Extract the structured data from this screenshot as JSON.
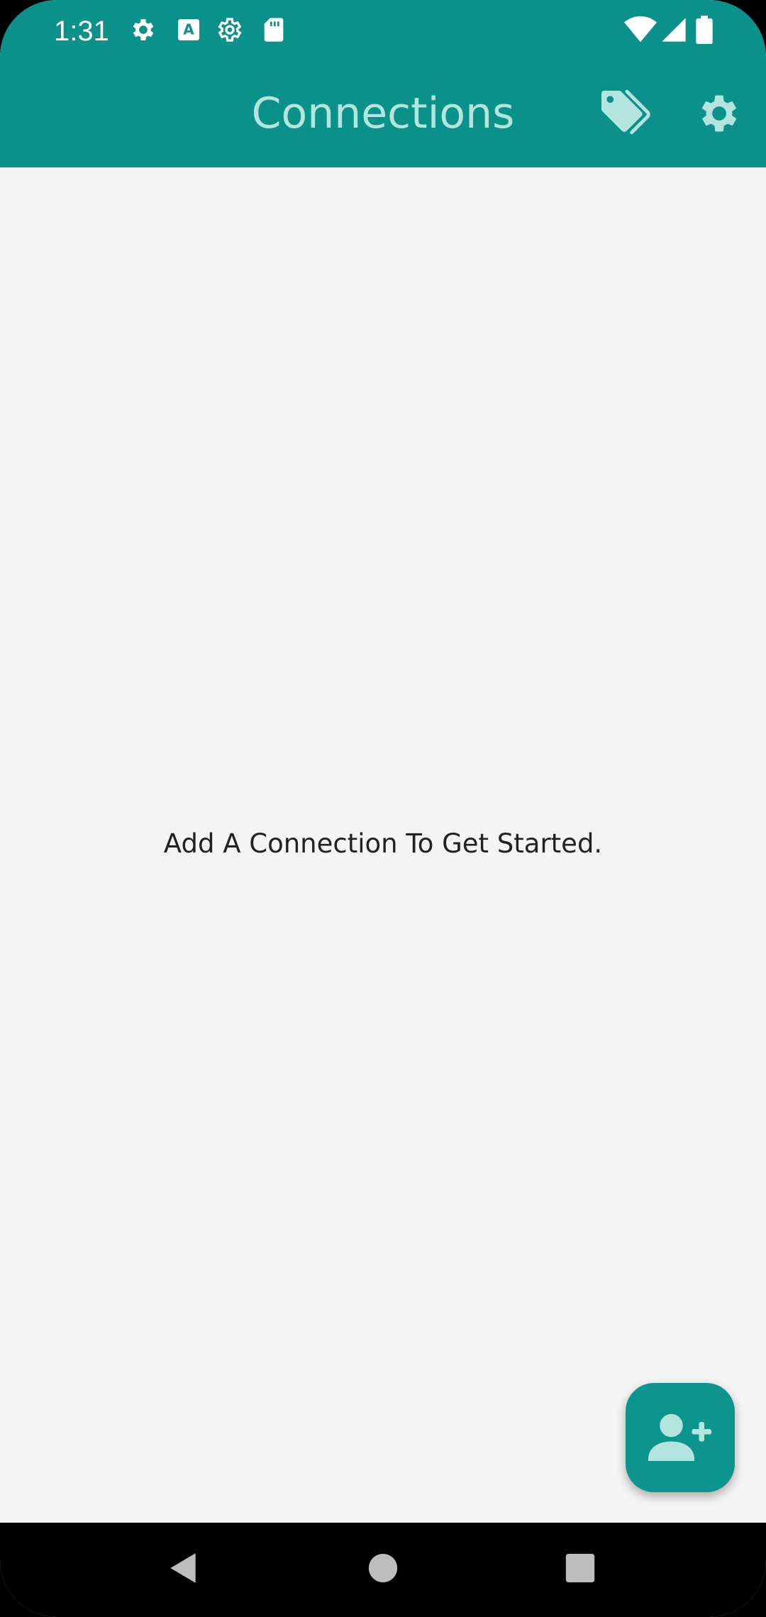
{
  "status_bar": {
    "time": "1:31",
    "left_icons": [
      "settings-icon",
      "font-a-icon",
      "settings-outline-icon",
      "sd-card-icon"
    ],
    "right_icons": [
      "wifi-icon",
      "cell-signal-icon",
      "battery-icon"
    ]
  },
  "app_bar": {
    "title": "Connections",
    "actions": [
      "tags-icon",
      "settings-icon"
    ]
  },
  "main": {
    "empty_message": "Add A Connection To Get Started."
  },
  "fab": {
    "icon": "add-person-icon"
  },
  "nav_bar": {
    "buttons": [
      "back-icon",
      "home-icon",
      "recents-icon"
    ]
  },
  "colors": {
    "primary": "#0a9189",
    "primary_light": "#b4e4e0",
    "background": "#f4f4f4",
    "fab": "#0c958c"
  }
}
